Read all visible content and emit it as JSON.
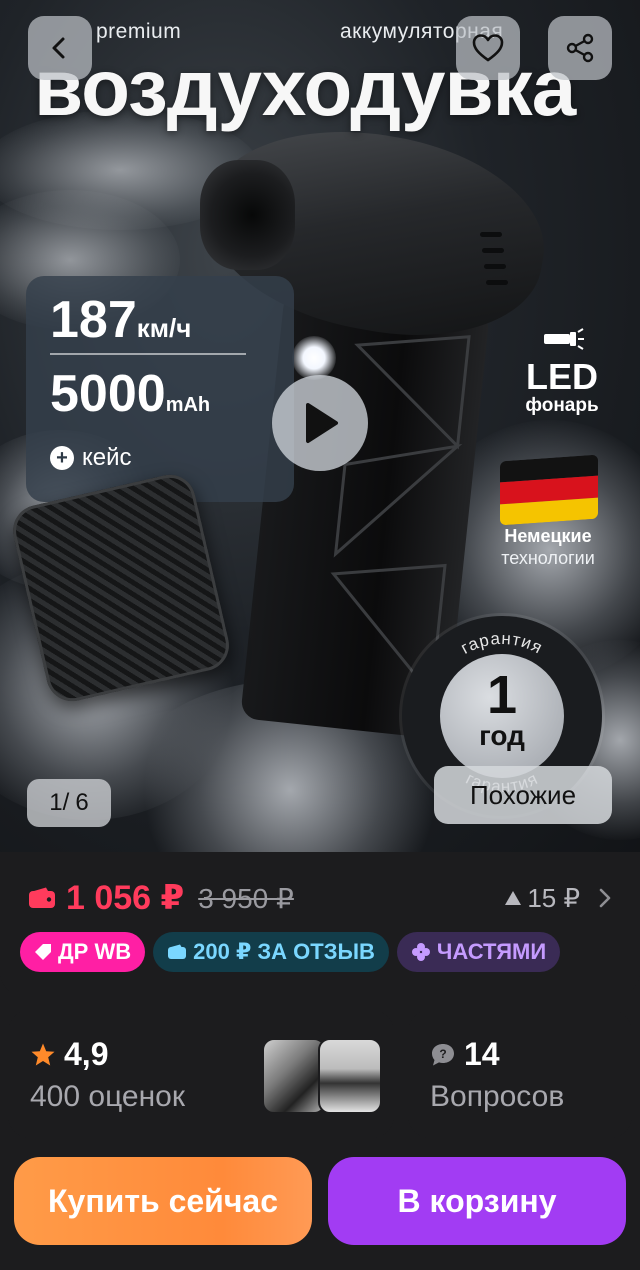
{
  "hero": {
    "subtitle_left": "premium",
    "subtitle_right": "аккумуляторная",
    "title": "воздуходувка",
    "speed_value": "187",
    "speed_unit": "км/ч",
    "battery_value": "5000",
    "battery_unit": "mAh",
    "case_label": "кейс",
    "led_title": "LED",
    "led_subtitle": "фонарь",
    "german_line1": "Немецкие",
    "german_line2": "технологии",
    "warranty_ring_text": "гарантия",
    "warranty_number": "1",
    "warranty_unit": "год",
    "image_counter_current": "1",
    "image_counter_total": "6",
    "similar_label": "Похожие"
  },
  "nav": {
    "back_icon": "chevron-left-icon",
    "favorite_icon": "heart-icon",
    "share_icon": "share-icon"
  },
  "price": {
    "current": "1 056 ₽",
    "old": "3 950 ₽",
    "delta": "15 ₽",
    "current_color": "#ff3b5c"
  },
  "badges": {
    "dr": "ДР WB",
    "review": "200 ₽ ЗА ОТЗЫВ",
    "parts": "ЧАСТЯМИ"
  },
  "stats": {
    "rating": "4,9",
    "ratings_count": "400 оценок",
    "questions_count": "14",
    "questions_label": "Вопросов"
  },
  "actions": {
    "buy_now": "Купить сейчас",
    "add_to_cart": "В корзину",
    "buy_color": "#ff8a3a",
    "cart_color": "#a23cf3"
  }
}
